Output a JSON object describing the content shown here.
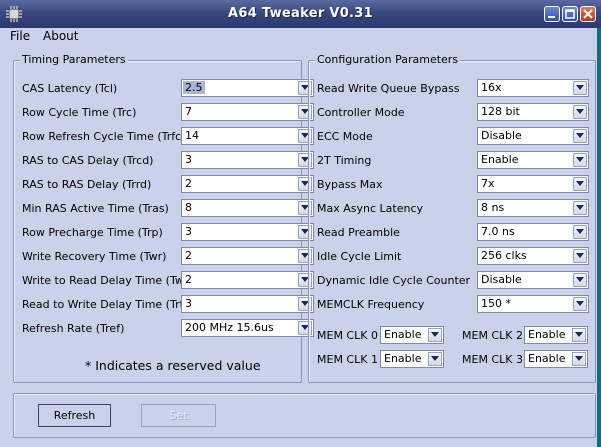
{
  "window": {
    "title": "A64 Tweaker V0.31"
  },
  "menu": [
    "File",
    "About"
  ],
  "timing": {
    "title": "Timing Parameters",
    "rows": [
      {
        "label": "CAS Latency (Tcl)",
        "value": "2.5"
      },
      {
        "label": "Row Cycle Time (Trc)",
        "value": "7"
      },
      {
        "label": "Row Refresh Cycle Time (Trfc)",
        "value": "14"
      },
      {
        "label": "RAS to CAS Delay (Trcd)",
        "value": "3"
      },
      {
        "label": "RAS to RAS Delay (Trrd)",
        "value": "2"
      },
      {
        "label": "Min RAS Active Time (Tras)",
        "value": "8"
      },
      {
        "label": "Row Precharge Time (Trp)",
        "value": "3"
      },
      {
        "label": "Write Recovery Time (Twr)",
        "value": "2"
      },
      {
        "label": "Write to Read Delay Time (Twtr)",
        "value": "2"
      },
      {
        "label": "Read to Write Delay Time (Trtw)",
        "value": "3"
      },
      {
        "label": "Refresh Rate (Tref)",
        "value": "200 MHz 15.6us"
      }
    ],
    "note": "* Indicates a reserved value"
  },
  "config": {
    "title": "Configuration Parameters",
    "rows": [
      {
        "label": "Read Write Queue Bypass",
        "value": "16x"
      },
      {
        "label": "Controller Mode",
        "value": "128 bit"
      },
      {
        "label": "ECC Mode",
        "value": "Disable"
      },
      {
        "label": "2T Timing",
        "value": "Enable"
      },
      {
        "label": "Bypass Max",
        "value": "7x"
      },
      {
        "label": "Max Async Latency",
        "value": "8 ns"
      },
      {
        "label": "Read Preamble",
        "value": "7.0 ns"
      },
      {
        "label": "Idle Cycle Limit",
        "value": "256 clks"
      },
      {
        "label": "Dynamic Idle Cycle Counter",
        "value": "Disable"
      },
      {
        "label": "MEMCLK Frequency",
        "value": "150 *"
      }
    ],
    "memclk": [
      {
        "label": "MEM CLK 0",
        "value": "Enable"
      },
      {
        "label": "MEM CLK 2",
        "value": "Enable"
      },
      {
        "label": "MEM CLK 1",
        "value": "Enable"
      },
      {
        "label": "MEM CLK 3",
        "value": "Enable"
      }
    ]
  },
  "buttons": {
    "refresh": "Refresh",
    "set": "Set"
  },
  "icons": {
    "app": "chip-icon",
    "minimize": "minimize-icon",
    "maximize": "maximize-icon",
    "close": "close-icon",
    "dropdown": "chevron-down-icon"
  },
  "colors": {
    "window_bg": "#c9d2ea",
    "titlebar": "#3a4880",
    "close": "#c8482a"
  }
}
